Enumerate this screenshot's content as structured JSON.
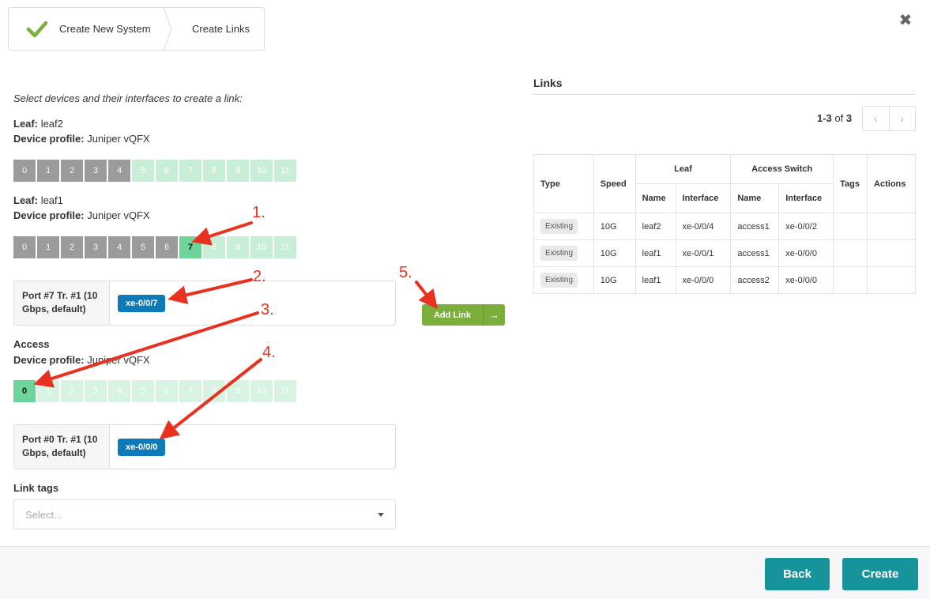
{
  "wizard": {
    "step1_label": "Create New System",
    "step2_label": "Create Links"
  },
  "instructions": "Select devices and their interfaces to create a link:",
  "leaf2": {
    "role_label": "Leaf:",
    "name": "leaf2",
    "profile_label": "Device profile:",
    "profile": "Juniper vQFX",
    "ports": [
      "0",
      "1",
      "2",
      "3",
      "4",
      "5",
      "6",
      "7",
      "8",
      "9",
      "10",
      "11"
    ]
  },
  "leaf1": {
    "role_label": "Leaf:",
    "name": "leaf1",
    "profile_label": "Device profile:",
    "profile": "Juniper vQFX",
    "ports": [
      "0",
      "1",
      "2",
      "3",
      "4",
      "5",
      "6",
      "7",
      "8",
      "9",
      "10",
      "11"
    ]
  },
  "leaf_port_box": {
    "label": "Port #7 Tr. #1 (10 Gbps, default)",
    "interface": "xe-0/0/7"
  },
  "access": {
    "title": "Access",
    "profile_label": "Device profile:",
    "profile": "Juniper vQFX",
    "ports": [
      "0",
      "1",
      "2",
      "3",
      "4",
      "5",
      "6",
      "7",
      "8",
      "9",
      "10",
      "11"
    ]
  },
  "access_port_box": {
    "label": "Port #0 Tr. #1 (10 Gbps, default)",
    "interface": "xe-0/0/0"
  },
  "link_tags": {
    "label": "Link tags",
    "placeholder": "Select..."
  },
  "add_link_label": "Add Link",
  "links_panel": {
    "title": "Links",
    "range": "1-3",
    "of": "of",
    "total": "3",
    "headers": {
      "type": "Type",
      "speed": "Speed",
      "leaf": "Leaf",
      "access_switch": "Access Switch",
      "name": "Name",
      "interface": "Interface",
      "tags": "Tags",
      "actions": "Actions"
    },
    "rows": [
      {
        "type": "Existing",
        "speed": "10G",
        "leaf_name": "leaf2",
        "leaf_if": "xe-0/0/4",
        "acc_name": "access1",
        "acc_if": "xe-0/0/2"
      },
      {
        "type": "Existing",
        "speed": "10G",
        "leaf_name": "leaf1",
        "leaf_if": "xe-0/0/1",
        "acc_name": "access1",
        "acc_if": "xe-0/0/0"
      },
      {
        "type": "Existing",
        "speed": "10G",
        "leaf_name": "leaf1",
        "leaf_if": "xe-0/0/0",
        "acc_name": "access2",
        "acc_if": "xe-0/0/0"
      }
    ]
  },
  "footer": {
    "back_label": "Back",
    "create_label": "Create"
  },
  "annotations": [
    "1.",
    "2.",
    "3.",
    "4.",
    "5."
  ],
  "colors": {
    "accent": "#17939c",
    "add_link": "#7cae3c",
    "interface_tag": "#0f7ab8",
    "arrow": "#e8321f"
  }
}
